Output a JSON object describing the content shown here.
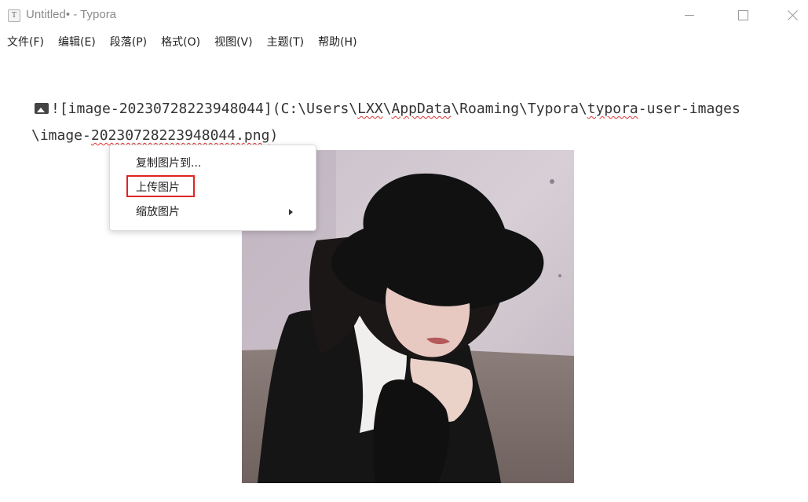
{
  "window": {
    "app_icon_letter": "T",
    "title": "Untitled• - Typora",
    "controls": [
      "minimize-icon",
      "maximize-icon",
      "close-icon"
    ]
  },
  "menubar": {
    "items": [
      "文件(F)",
      "编辑(E)",
      "段落(P)",
      "格式(O)",
      "视图(V)",
      "主题(T)",
      "帮助(H)"
    ]
  },
  "editor": {
    "line1": {
      "prefix": "![image-20230728223948044](C:\\Users\\",
      "user": "LXX",
      "sep1": "\\",
      "appdata": "AppData",
      "mid": "\\Roaming\\Typora\\",
      "typora": "typora",
      "suffix": "-user-images"
    },
    "line2": {
      "prefix": "\\image-",
      "filename": "20230728223948044.png",
      "suffix": ")"
    }
  },
  "context_menu": {
    "items": [
      {
        "label": "复制图片到..."
      },
      {
        "label": "上传图片",
        "highlighted": true
      },
      {
        "label": "缩放图片",
        "has_submenu": true
      }
    ],
    "highlight_color": "#e02424"
  }
}
